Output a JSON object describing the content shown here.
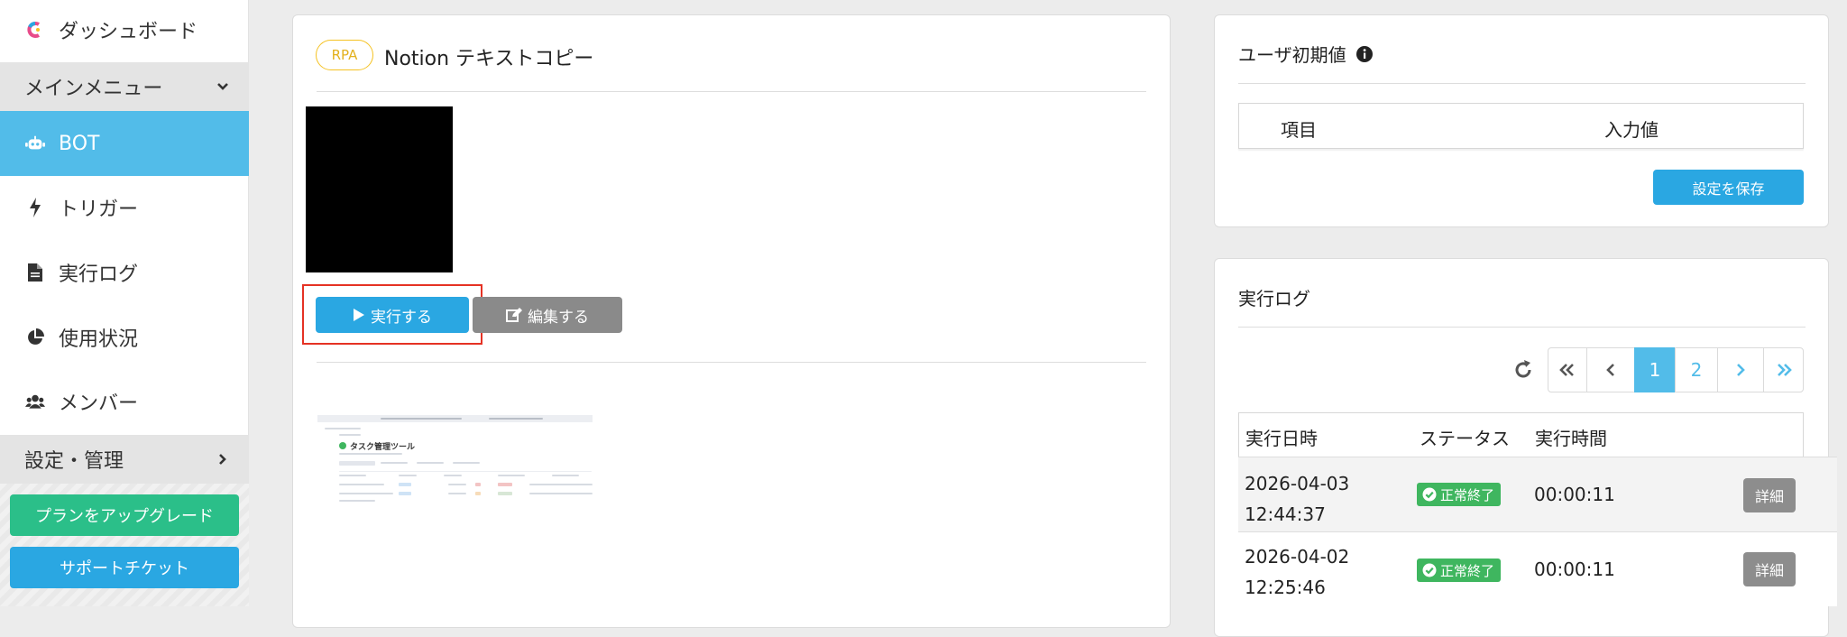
{
  "sidebar": {
    "dashboard": "ダッシュボード",
    "main_menu": "メインメニュー",
    "items": [
      {
        "label": "BOT",
        "icon": "robot-icon"
      },
      {
        "label": "トリガー",
        "icon": "bolt-icon"
      },
      {
        "label": "実行ログ",
        "icon": "file-icon"
      },
      {
        "label": "使用状況",
        "icon": "pie-chart-icon"
      },
      {
        "label": "メンバー",
        "icon": "users-icon"
      }
    ],
    "settings": "設定・管理",
    "upgrade_button": "プランをアップグレード",
    "support_button": "サポートチケット"
  },
  "bot": {
    "badge": "RPA",
    "title": "Notion テキストコピー",
    "run_button": "実行する",
    "edit_button": "編集する",
    "thumbnail": {
      "title": "タスク管理ツール"
    }
  },
  "user_defaults": {
    "title": "ユーザ初期値",
    "col_item": "項目",
    "col_value": "入力値",
    "save_button": "設定を保存"
  },
  "exec_log": {
    "title": "実行ログ",
    "pages": [
      "1",
      "2"
    ],
    "current_page": "1",
    "headers": [
      "実行日時",
      "ステータス",
      "実行時間"
    ],
    "rows": [
      {
        "date": "2026-04-03",
        "time": "12:44:37",
        "status": "正常終了",
        "duration": "00:00:11",
        "detail": "詳細"
      },
      {
        "date": "2026-04-02",
        "time": "12:25:46",
        "status": "正常終了",
        "duration": "00:00:11",
        "detail": "詳細"
      }
    ]
  },
  "colors": {
    "accent": "#52bce9",
    "button_blue": "#2aa7e2",
    "upgrade_green": "#2bbf89",
    "edit_gray": "#8a8a8a",
    "status_green": "#3fb65f",
    "highlight_red": "#e53224",
    "rpa_yellow": "#f5c222"
  }
}
